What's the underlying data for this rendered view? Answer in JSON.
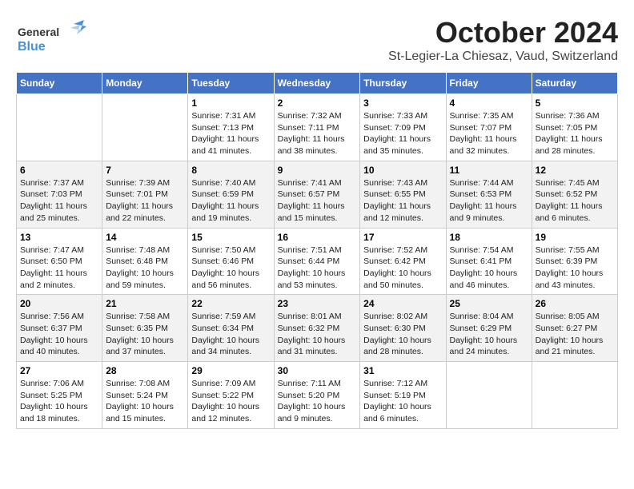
{
  "header": {
    "logo_general": "General",
    "logo_blue": "Blue",
    "month": "October 2024",
    "location": "St-Legier-La Chiesaz, Vaud, Switzerland"
  },
  "weekdays": [
    "Sunday",
    "Monday",
    "Tuesday",
    "Wednesday",
    "Thursday",
    "Friday",
    "Saturday"
  ],
  "weeks": [
    [
      {
        "day": "",
        "sunrise": "",
        "sunset": "",
        "daylight": ""
      },
      {
        "day": "",
        "sunrise": "",
        "sunset": "",
        "daylight": ""
      },
      {
        "day": "1",
        "sunrise": "Sunrise: 7:31 AM",
        "sunset": "Sunset: 7:13 PM",
        "daylight": "Daylight: 11 hours and 41 minutes."
      },
      {
        "day": "2",
        "sunrise": "Sunrise: 7:32 AM",
        "sunset": "Sunset: 7:11 PM",
        "daylight": "Daylight: 11 hours and 38 minutes."
      },
      {
        "day": "3",
        "sunrise": "Sunrise: 7:33 AM",
        "sunset": "Sunset: 7:09 PM",
        "daylight": "Daylight: 11 hours and 35 minutes."
      },
      {
        "day": "4",
        "sunrise": "Sunrise: 7:35 AM",
        "sunset": "Sunset: 7:07 PM",
        "daylight": "Daylight: 11 hours and 32 minutes."
      },
      {
        "day": "5",
        "sunrise": "Sunrise: 7:36 AM",
        "sunset": "Sunset: 7:05 PM",
        "daylight": "Daylight: 11 hours and 28 minutes."
      }
    ],
    [
      {
        "day": "6",
        "sunrise": "Sunrise: 7:37 AM",
        "sunset": "Sunset: 7:03 PM",
        "daylight": "Daylight: 11 hours and 25 minutes."
      },
      {
        "day": "7",
        "sunrise": "Sunrise: 7:39 AM",
        "sunset": "Sunset: 7:01 PM",
        "daylight": "Daylight: 11 hours and 22 minutes."
      },
      {
        "day": "8",
        "sunrise": "Sunrise: 7:40 AM",
        "sunset": "Sunset: 6:59 PM",
        "daylight": "Daylight: 11 hours and 19 minutes."
      },
      {
        "day": "9",
        "sunrise": "Sunrise: 7:41 AM",
        "sunset": "Sunset: 6:57 PM",
        "daylight": "Daylight: 11 hours and 15 minutes."
      },
      {
        "day": "10",
        "sunrise": "Sunrise: 7:43 AM",
        "sunset": "Sunset: 6:55 PM",
        "daylight": "Daylight: 11 hours and 12 minutes."
      },
      {
        "day": "11",
        "sunrise": "Sunrise: 7:44 AM",
        "sunset": "Sunset: 6:53 PM",
        "daylight": "Daylight: 11 hours and 9 minutes."
      },
      {
        "day": "12",
        "sunrise": "Sunrise: 7:45 AM",
        "sunset": "Sunset: 6:52 PM",
        "daylight": "Daylight: 11 hours and 6 minutes."
      }
    ],
    [
      {
        "day": "13",
        "sunrise": "Sunrise: 7:47 AM",
        "sunset": "Sunset: 6:50 PM",
        "daylight": "Daylight: 11 hours and 2 minutes."
      },
      {
        "day": "14",
        "sunrise": "Sunrise: 7:48 AM",
        "sunset": "Sunset: 6:48 PM",
        "daylight": "Daylight: 10 hours and 59 minutes."
      },
      {
        "day": "15",
        "sunrise": "Sunrise: 7:50 AM",
        "sunset": "Sunset: 6:46 PM",
        "daylight": "Daylight: 10 hours and 56 minutes."
      },
      {
        "day": "16",
        "sunrise": "Sunrise: 7:51 AM",
        "sunset": "Sunset: 6:44 PM",
        "daylight": "Daylight: 10 hours and 53 minutes."
      },
      {
        "day": "17",
        "sunrise": "Sunrise: 7:52 AM",
        "sunset": "Sunset: 6:42 PM",
        "daylight": "Daylight: 10 hours and 50 minutes."
      },
      {
        "day": "18",
        "sunrise": "Sunrise: 7:54 AM",
        "sunset": "Sunset: 6:41 PM",
        "daylight": "Daylight: 10 hours and 46 minutes."
      },
      {
        "day": "19",
        "sunrise": "Sunrise: 7:55 AM",
        "sunset": "Sunset: 6:39 PM",
        "daylight": "Daylight: 10 hours and 43 minutes."
      }
    ],
    [
      {
        "day": "20",
        "sunrise": "Sunrise: 7:56 AM",
        "sunset": "Sunset: 6:37 PM",
        "daylight": "Daylight: 10 hours and 40 minutes."
      },
      {
        "day": "21",
        "sunrise": "Sunrise: 7:58 AM",
        "sunset": "Sunset: 6:35 PM",
        "daylight": "Daylight: 10 hours and 37 minutes."
      },
      {
        "day": "22",
        "sunrise": "Sunrise: 7:59 AM",
        "sunset": "Sunset: 6:34 PM",
        "daylight": "Daylight: 10 hours and 34 minutes."
      },
      {
        "day": "23",
        "sunrise": "Sunrise: 8:01 AM",
        "sunset": "Sunset: 6:32 PM",
        "daylight": "Daylight: 10 hours and 31 minutes."
      },
      {
        "day": "24",
        "sunrise": "Sunrise: 8:02 AM",
        "sunset": "Sunset: 6:30 PM",
        "daylight": "Daylight: 10 hours and 28 minutes."
      },
      {
        "day": "25",
        "sunrise": "Sunrise: 8:04 AM",
        "sunset": "Sunset: 6:29 PM",
        "daylight": "Daylight: 10 hours and 24 minutes."
      },
      {
        "day": "26",
        "sunrise": "Sunrise: 8:05 AM",
        "sunset": "Sunset: 6:27 PM",
        "daylight": "Daylight: 10 hours and 21 minutes."
      }
    ],
    [
      {
        "day": "27",
        "sunrise": "Sunrise: 7:06 AM",
        "sunset": "Sunset: 5:25 PM",
        "daylight": "Daylight: 10 hours and 18 minutes."
      },
      {
        "day": "28",
        "sunrise": "Sunrise: 7:08 AM",
        "sunset": "Sunset: 5:24 PM",
        "daylight": "Daylight: 10 hours and 15 minutes."
      },
      {
        "day": "29",
        "sunrise": "Sunrise: 7:09 AM",
        "sunset": "Sunset: 5:22 PM",
        "daylight": "Daylight: 10 hours and 12 minutes."
      },
      {
        "day": "30",
        "sunrise": "Sunrise: 7:11 AM",
        "sunset": "Sunset: 5:20 PM",
        "daylight": "Daylight: 10 hours and 9 minutes."
      },
      {
        "day": "31",
        "sunrise": "Sunrise: 7:12 AM",
        "sunset": "Sunset: 5:19 PM",
        "daylight": "Daylight: 10 hours and 6 minutes."
      },
      {
        "day": "",
        "sunrise": "",
        "sunset": "",
        "daylight": ""
      },
      {
        "day": "",
        "sunrise": "",
        "sunset": "",
        "daylight": ""
      }
    ]
  ]
}
